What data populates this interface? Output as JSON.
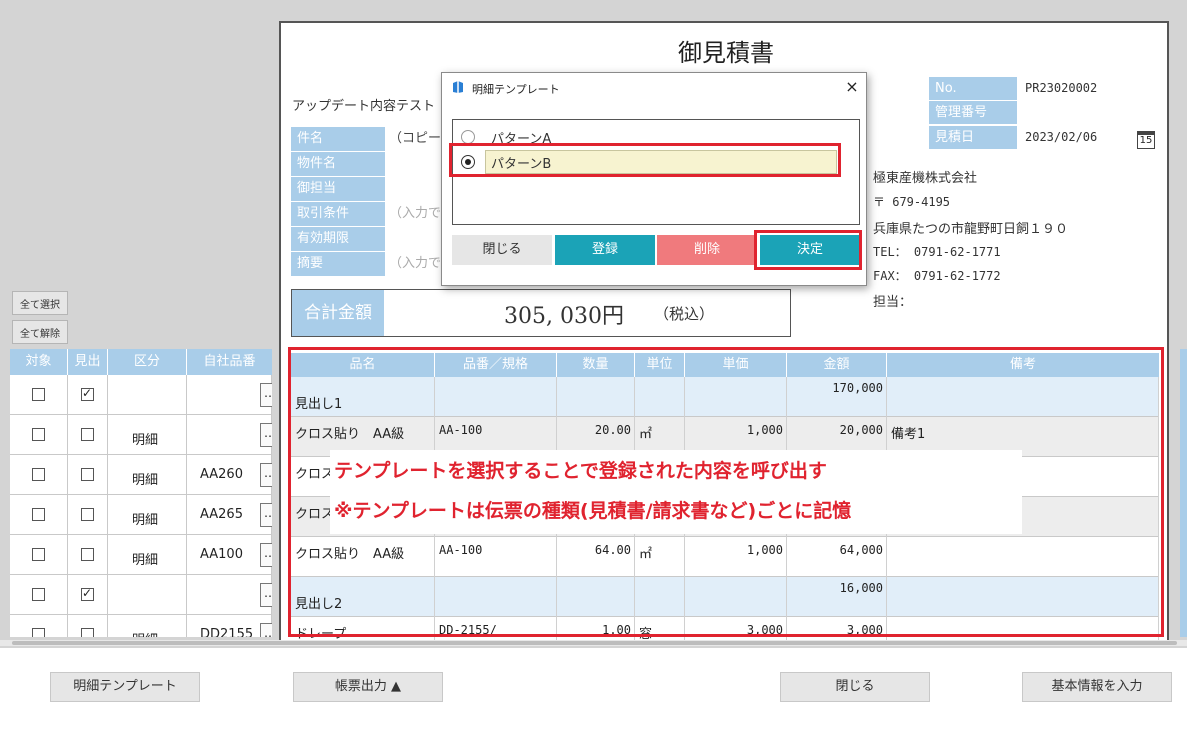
{
  "left_panel": {
    "select_all": "全て選択",
    "deselect_all": "全て解除",
    "headers": [
      "対象",
      "見出",
      "区分",
      "自社品番"
    ],
    "rows": [
      {
        "target": false,
        "heading": true,
        "kubun": "",
        "code": ""
      },
      {
        "target": false,
        "heading": false,
        "kubun": "明細",
        "code": ""
      },
      {
        "target": false,
        "heading": false,
        "kubun": "明細",
        "code": "AA260"
      },
      {
        "target": false,
        "heading": false,
        "kubun": "明細",
        "code": "AA265"
      },
      {
        "target": false,
        "heading": false,
        "kubun": "明細",
        "code": "AA100"
      },
      {
        "target": false,
        "heading": true,
        "kubun": "",
        "code": ""
      },
      {
        "target": false,
        "heading": false,
        "kubun": "明細",
        "code": "DD2155"
      }
    ],
    "more_button": "…"
  },
  "doc": {
    "title": "御見積書",
    "update_note": "アップデート内容テスト",
    "fields": [
      {
        "label": "件名",
        "value": "（コピー）",
        "placeholder": false
      },
      {
        "label": "物件名",
        "value": "",
        "placeholder": false
      },
      {
        "label": "御担当",
        "value": "",
        "placeholder": false
      },
      {
        "label": "取引条件",
        "value": "（入力でき",
        "placeholder": true
      },
      {
        "label": "有効期限",
        "value": "",
        "placeholder": false
      },
      {
        "label": "摘要",
        "value": "（入力でき",
        "placeholder": true
      }
    ],
    "total_label": "合計金額",
    "total_amount": "305, 030円",
    "total_tax": "（税込）",
    "meta": [
      {
        "label": "No.",
        "value": "PR23020002"
      },
      {
        "label": "管理番号",
        "value": ""
      },
      {
        "label": "見積日",
        "value": "2023/02/06"
      }
    ],
    "calendar_day": "15",
    "company": {
      "name": "極東産機株式会社",
      "zip": "〒 679-4195",
      "address": "兵庫県たつの市龍野町日飼１９０",
      "tel": "TEL： 0791-62-1771",
      "fax": "FAX： 0791-62-1772",
      "staff": "担当："
    }
  },
  "detail": {
    "headers": [
      "品名",
      "品番／規格",
      "数量",
      "単位",
      "単価",
      "金額",
      "備考"
    ],
    "rows": [
      {
        "type": "heading",
        "name": "見出し1",
        "amount": "170,000"
      },
      {
        "type": "item",
        "name": "クロス貼り　AA級",
        "spec": "AA-100",
        "qty": "20.00",
        "unit": "㎡",
        "price": "1,000",
        "amount": "20,000",
        "note": "備考1"
      },
      {
        "type": "item",
        "name": "クロス",
        "spec": "",
        "qty": "",
        "unit": "",
        "price": "",
        "amount": "",
        "note": ""
      },
      {
        "type": "item",
        "name": "クロス",
        "spec": "",
        "qty": "",
        "unit": "",
        "price": "",
        "amount": "",
        "note": ""
      },
      {
        "type": "item",
        "name": "クロス貼り　AA級",
        "spec": "AA-100",
        "qty": "64.00",
        "unit": "㎡",
        "price": "1,000",
        "amount": "64,000",
        "note": ""
      },
      {
        "type": "heading",
        "name": "見出し2",
        "amount": "16,000"
      },
      {
        "type": "item",
        "name": "ドレープ",
        "spec": "DD-2155/",
        "qty": "1.00",
        "unit": "窓",
        "price": "3,000",
        "amount": "3,000",
        "note": ""
      }
    ]
  },
  "annotation": {
    "line1": "テンプレートを選択することで登録された内容を呼び出す",
    "line2": "※テンプレートは伝票の種類(見積書/請求書など)ごとに記憶"
  },
  "dialog": {
    "title": "明細テンプレート",
    "close": "×",
    "options": [
      {
        "label": "パターンA",
        "selected": false
      },
      {
        "label": "パターンB",
        "selected": true
      }
    ],
    "buttons": {
      "close": "閉じる",
      "register": "登録",
      "delete": "削除",
      "decide": "決定"
    }
  },
  "colors": {
    "accent_blue": "#a9cde9",
    "register_teal": "#1ba3b7",
    "delete_pink": "#f07a7d",
    "highlight_red": "#e0232f"
  },
  "bottom": {
    "template_button": "明細テンプレート",
    "print_button": "帳票出力 ▲",
    "close_button": "閉じる",
    "basic_info_button": "基本情報を入力"
  }
}
